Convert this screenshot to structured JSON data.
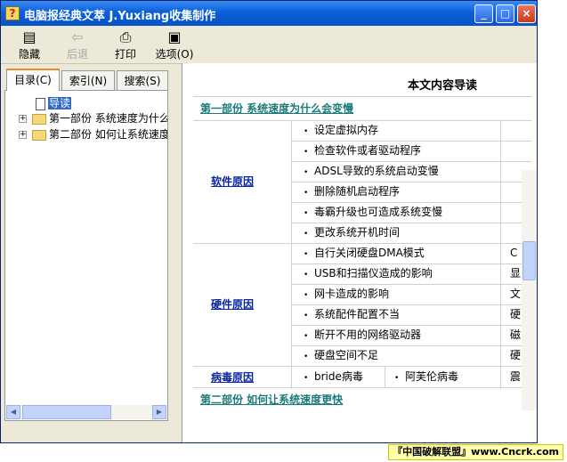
{
  "window": {
    "title": "电脑报经典文萃 J.Yuxiang收集制作",
    "controls": {
      "minimize": "_",
      "maximize": "□",
      "close": "×"
    }
  },
  "toolbar": {
    "hide": "隐藏",
    "back": "后退",
    "print": "打印",
    "options": "选项(O)"
  },
  "left_panel": {
    "tabs": [
      "目录(C)",
      "索引(N)",
      "搜索(S)"
    ],
    "tree": {
      "guide": "导读",
      "part1": "第一部份 系统速度为什么",
      "part2": "第二部份 如何让系统速度"
    }
  },
  "main": {
    "page_title": "本文内容导读",
    "part1_heading": "第一部份 系统速度为什么会变慢",
    "part2_heading": "第二部份 如何让系统速度更快",
    "groups": [
      {
        "label": "软件原因",
        "items": [
          "设定虚拟内存",
          "检查软件或者驱动程序",
          "ADSL导致的系统启动变慢",
          "删除随机启动程序",
          "毒霸升级也可造成系统变慢",
          "更改系统开机时间"
        ],
        "cut_col": [
          "",
          "",
          "",
          "",
          "",
          ""
        ]
      },
      {
        "label": "硬件原因",
        "items": [
          "自行关闭硬盘DMA模式",
          "USB和扫描仪造成的影响",
          "网卡造成的影响",
          "系统配件配置不当",
          "断开不用的网络驱动器",
          "硬盘空间不足"
        ],
        "cut_col": [
          "C",
          "显",
          "文",
          "硬",
          "磁",
          "硬"
        ]
      },
      {
        "label": "病毒原因",
        "items": [
          "bride病毒"
        ],
        "extra": "阿芙伦病毒",
        "cut_col": [
          "震"
        ]
      }
    ]
  },
  "watermark": "『中国破解联盟』www.Cncrk.com"
}
